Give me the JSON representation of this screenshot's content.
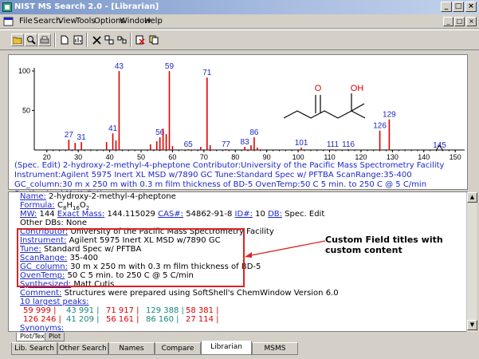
{
  "window": {
    "title": "NIST MS Search 2.0 - [Librarian]"
  },
  "menu": {
    "items": [
      "File",
      "Search",
      "View",
      "Tools",
      "Options",
      "Window",
      "Help"
    ]
  },
  "spectrum": {
    "peaks": [
      {
        "mz": 27,
        "intensity": 13,
        "label": "27"
      },
      {
        "mz": 29,
        "intensity": 9,
        "label": ""
      },
      {
        "mz": 31,
        "intensity": 10,
        "label": "31"
      },
      {
        "mz": 39,
        "intensity": 10,
        "label": ""
      },
      {
        "mz": 41,
        "intensity": 21,
        "label": "41"
      },
      {
        "mz": 42,
        "intensity": 12,
        "label": ""
      },
      {
        "mz": 43,
        "intensity": 99.9,
        "label": "43"
      },
      {
        "mz": 53,
        "intensity": 7,
        "label": ""
      },
      {
        "mz": 55,
        "intensity": 11,
        "label": ""
      },
      {
        "mz": 56,
        "intensity": 16,
        "label": "56"
      },
      {
        "mz": 57,
        "intensity": 27,
        "label": ""
      },
      {
        "mz": 58,
        "intensity": 20,
        "label": ""
      },
      {
        "mz": 59,
        "intensity": 99.9,
        "label": "59"
      },
      {
        "mz": 60,
        "intensity": 5,
        "label": ""
      },
      {
        "mz": 65,
        "intensity": 1,
        "label": "65"
      },
      {
        "mz": 69,
        "intensity": 4,
        "label": ""
      },
      {
        "mz": 71,
        "intensity": 91.7,
        "label": "71"
      },
      {
        "mz": 72,
        "intensity": 6,
        "label": ""
      },
      {
        "mz": 77,
        "intensity": 1,
        "label": "77"
      },
      {
        "mz": 83,
        "intensity": 4,
        "label": "83"
      },
      {
        "mz": 85,
        "intensity": 6,
        "label": ""
      },
      {
        "mz": 86,
        "intensity": 16,
        "label": "86"
      },
      {
        "mz": 87,
        "intensity": 3,
        "label": ""
      },
      {
        "mz": 101,
        "intensity": 3,
        "label": "101"
      },
      {
        "mz": 111,
        "intensity": 1,
        "label": "111"
      },
      {
        "mz": 116,
        "intensity": 1,
        "label": "116"
      },
      {
        "mz": 126,
        "intensity": 24.6,
        "label": "126"
      },
      {
        "mz": 129,
        "intensity": 38.8,
        "label": "129"
      },
      {
        "mz": 145,
        "intensity": 0,
        "label": "145"
      }
    ],
    "x_ticks": [
      "20",
      "30",
      "40",
      "50",
      "60",
      "70",
      "80",
      "90",
      "100",
      "110",
      "120",
      "130",
      "140",
      "150"
    ],
    "xlim": [
      16,
      153
    ],
    "y_ticks": [
      "50",
      "100"
    ],
    "ylim": [
      0,
      100
    ],
    "structure_labels": {
      "o": "O",
      "oh": "OH"
    }
  },
  "caption": "(Spec. Edit) 2-hydroxy-2-methyl-4-pheptone Contributor:University of the Pacific Mass Spectrometry Facility Instrument:Agilent 5975 Inert XL MSD w/7890 GC Tune:Standard Spec w/ PFTBA ScanRange:35-400 GC_column:30 m x 250 m with 0.3 m film thickness of BD-5 OvenTemp:50 C 5 min. to 250 C @ 5 C/min Synthesized:Matt Cutis",
  "info": {
    "name_label": "Name:",
    "name": "2-hydroxy-2-methyl-4-pheptone",
    "formula_label": "Formula:",
    "formula_c": "C",
    "formula_c_n": "8",
    "formula_h": "H",
    "formula_h_n": "16",
    "formula_o": "O",
    "formula_o_n": "2",
    "mw_label": "MW:",
    "mw": "144",
    "exact_mass_label": "Exact Mass:",
    "exact_mass": "144.115029",
    "cas_label": "CAS#:",
    "cas": "54862-91-8",
    "id_label": "ID#:",
    "id": "10",
    "db_label": "DB:",
    "db": "Spec. Edit",
    "other_dbs_label": "Other DBs:",
    "other_dbs": "None",
    "contributor_label": "Contributor:",
    "contributor": "University of the Pacific Mass Spectrometry Facility",
    "instrument_label": "Instrument:",
    "instrument": "Agilent 5975 Inert XL MSD w/7890 GC",
    "tune_label": "Tune:",
    "tune": "Standard Spec w/ PFTBA",
    "scanrange_label": "ScanRange:",
    "scanrange": "35-400",
    "gc_column_label": "GC_column:",
    "gc_column": "30 m x 250 m with 0.3 m film thickness of BD-5",
    "oventemp_label": "OvenTemp:",
    "oventemp": "50 C 5 min. to 250 C @ 5 C/min",
    "synthesized_label": "Synthesized:",
    "synthesized": "Matt Cutis",
    "comment_label": "Comment:",
    "comment": "Structures were prepared using SoftShell's ChemWindow Version 6.0",
    "largest_peaks_label": "10 largest peaks:",
    "peaks_row1": [
      [
        "59",
        "999"
      ],
      [
        "43",
        "991"
      ],
      [
        "71",
        "917"
      ],
      [
        "129",
        "388"
      ],
      [
        "58",
        "381"
      ]
    ],
    "peaks_row2": [
      [
        "126",
        "246"
      ],
      [
        "41",
        "209"
      ],
      [
        "56",
        "161"
      ],
      [
        "86",
        "160"
      ],
      [
        "27",
        "114"
      ]
    ],
    "synonyms_label": "Synonyms:"
  },
  "callout": "Custom Field titles with custom content",
  "subtabs": [
    "Plot/Text",
    "Plot"
  ],
  "tabs": [
    "Lib. Search",
    "Other Search",
    "Names",
    "Compare",
    "Librarian",
    "MSMS"
  ]
}
